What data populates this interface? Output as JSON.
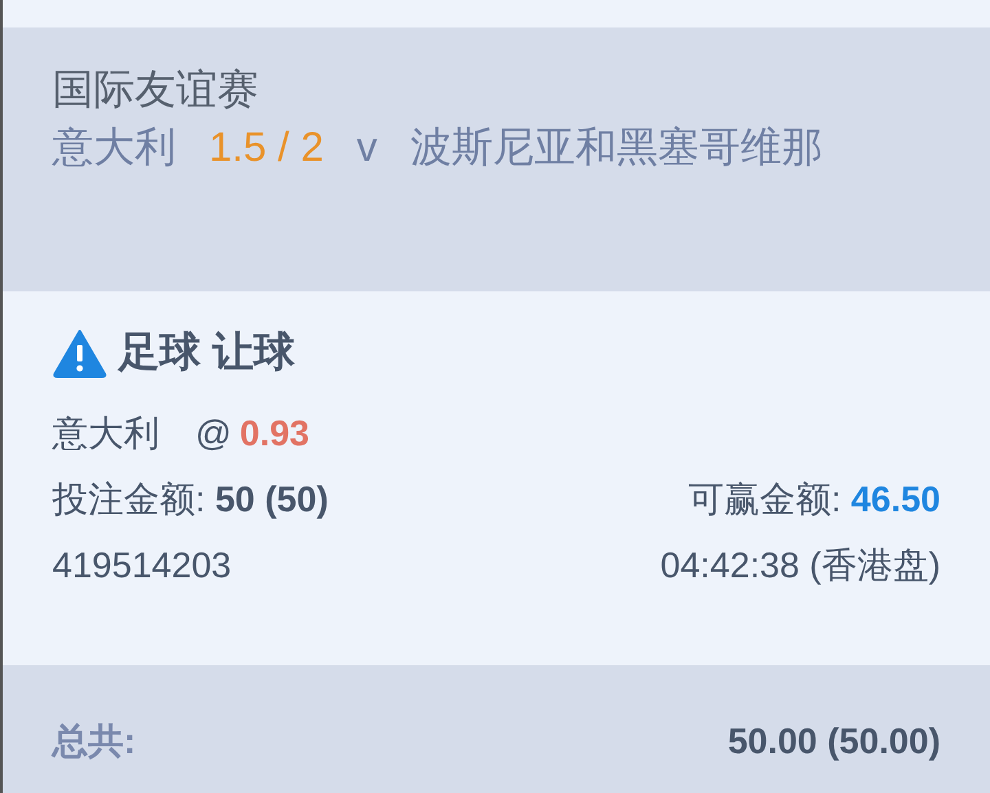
{
  "match": {
    "league": "国际友谊赛",
    "home": "意大利",
    "handicap": "1.5 / 2",
    "versus": "v",
    "away": "波斯尼亚和黑塞哥维那"
  },
  "bet": {
    "title": "足球 让球",
    "selection": "意大利",
    "at": "@",
    "odds": "0.93",
    "stake_label": "投注金额:",
    "stake": "50 (50)",
    "win_label": "可赢金额:",
    "win": "46.50",
    "ticket": "419514203",
    "time": "04:42:38 (香港盘)"
  },
  "total": {
    "label": "总共:",
    "value": "50.00 (50.00)"
  }
}
